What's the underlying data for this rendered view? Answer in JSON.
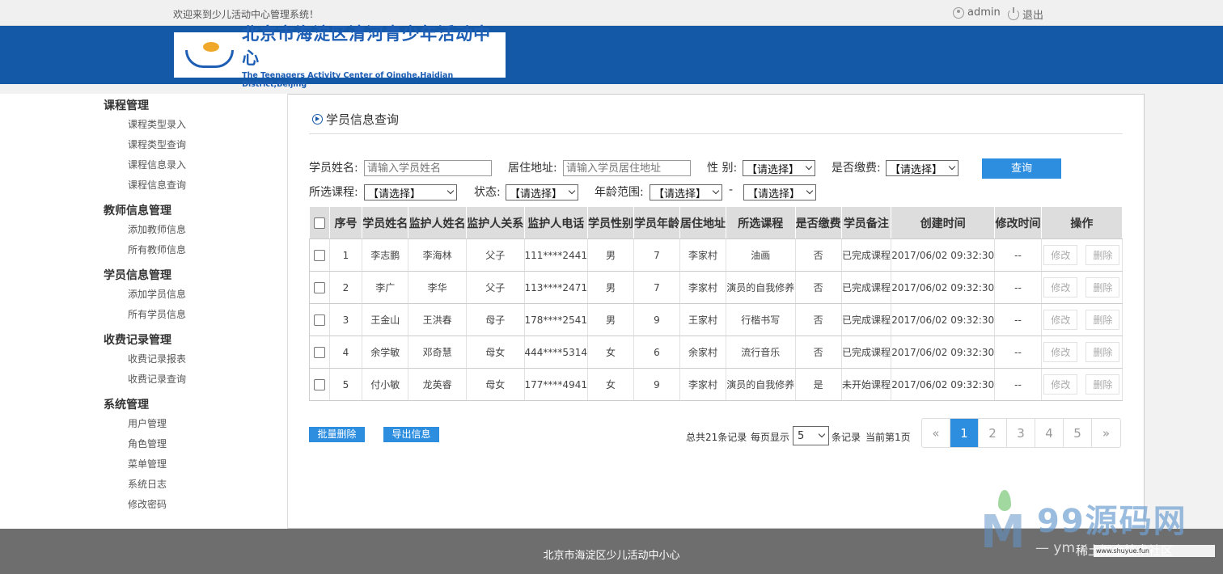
{
  "topbar": {
    "welcome": "欢迎来到少儿活动中心管理系统！",
    "user": "admin",
    "logout": "退出"
  },
  "logo": {
    "cn": "北京市海淀区清河青少年活动中心",
    "en": "The Teenagers Activity Center of Qinghe,Haidian District,Beijing"
  },
  "sidebar": {
    "groups": [
      {
        "title": "课程管理",
        "items": [
          "课程类型录入",
          "课程类型查询",
          "课程信息录入",
          "课程信息查询"
        ]
      },
      {
        "title": "教师信息管理",
        "items": [
          "添加教师信息",
          "所有教师信息"
        ]
      },
      {
        "title": "学员信息管理",
        "items": [
          "添加学员信息",
          "所有学员信息"
        ]
      },
      {
        "title": "收费记录管理",
        "items": [
          "收费记录报表",
          "收费记录查询"
        ]
      },
      {
        "title": "系统管理",
        "items": [
          "用户管理",
          "角色管理",
          "菜单管理",
          "系统日志",
          "修改密码"
        ]
      }
    ]
  },
  "main": {
    "title": "学员信息查询",
    "filters": {
      "name_label": "学员姓名:",
      "name_placeholder": "请输入学员姓名",
      "addr_label": "居住地址:",
      "addr_placeholder": "请输入学员居住地址",
      "gender_label": "性 别:",
      "gender_value": "【请选择】",
      "paid_label": "是否缴费:",
      "paid_value": "【请选择】",
      "course_label": "所选课程:",
      "course_value": "【请选择】",
      "status_label": "状态:",
      "status_value": "【请选择】",
      "age_label": "年龄范围:",
      "age_from": "【请选择】",
      "age_sep": "-",
      "age_to": "【请选择】",
      "search_button": "查询"
    },
    "table": {
      "headers": [
        "序号",
        "学员姓名",
        "监护人姓名",
        "监护人关系",
        "监护人电话",
        "学员性别",
        "学员年龄",
        "居住地址",
        "所选课程",
        "是否缴费",
        "学员备注",
        "创建时间",
        "修改时间",
        "操作"
      ],
      "rows": [
        [
          "1",
          "李志鹏",
          "李海林",
          "父子",
          "111****2441",
          "男",
          "7",
          "李家村",
          "油画",
          "否",
          "已完成课程",
          "2017/06/02 09:32:30",
          "--"
        ],
        [
          "2",
          "李广",
          "李华",
          "父子",
          "113****2471",
          "男",
          "7",
          "李家村",
          "演员的自我修养",
          "否",
          "已完成课程",
          "2017/06/02 09:32:30",
          "--"
        ],
        [
          "3",
          "王金山",
          "王洪春",
          "母子",
          "178****2541",
          "男",
          "9",
          "王家村",
          "行楷书写",
          "否",
          "已完成课程",
          "2017/06/02 09:32:30",
          "--"
        ],
        [
          "4",
          "余学敏",
          "邓奇慧",
          "母女",
          "444****5314",
          "女",
          "6",
          "余家村",
          "流行音乐",
          "否",
          "已完成课程",
          "2017/06/02 09:32:30",
          "--"
        ],
        [
          "5",
          "付小敏",
          "龙英睿",
          "母女",
          "177****4941",
          "女",
          "9",
          "李家村",
          "演员的自我修养",
          "是",
          "未开始课程",
          "2017/06/02 09:32:30",
          "--"
        ]
      ],
      "edit_label": "修改",
      "delete_label": "删除"
    },
    "batch_delete": "批量删除",
    "export": "导出信息",
    "pagination": {
      "total": "总共21条记录",
      "per_page_label": "每页显示",
      "per_page_value": "5",
      "records_label": "条记录",
      "current": "当前第1页",
      "prev": "«",
      "pages": [
        "1",
        "2",
        "3",
        "4",
        "5"
      ],
      "next": "»",
      "active_page": "1"
    }
  },
  "footer": {
    "text": "北京市海淀区少儿活动中小心"
  },
  "watermark": {
    "brand": "99源码网",
    "sub1": "— ym",
    "sub2": "稀土掘金技术社区",
    "box": "www.shuyue.fun"
  },
  "colors": {
    "header_blue": "#1459a8",
    "button_blue": "#2d8ee0",
    "footer_gray": "#6e6e6e"
  }
}
